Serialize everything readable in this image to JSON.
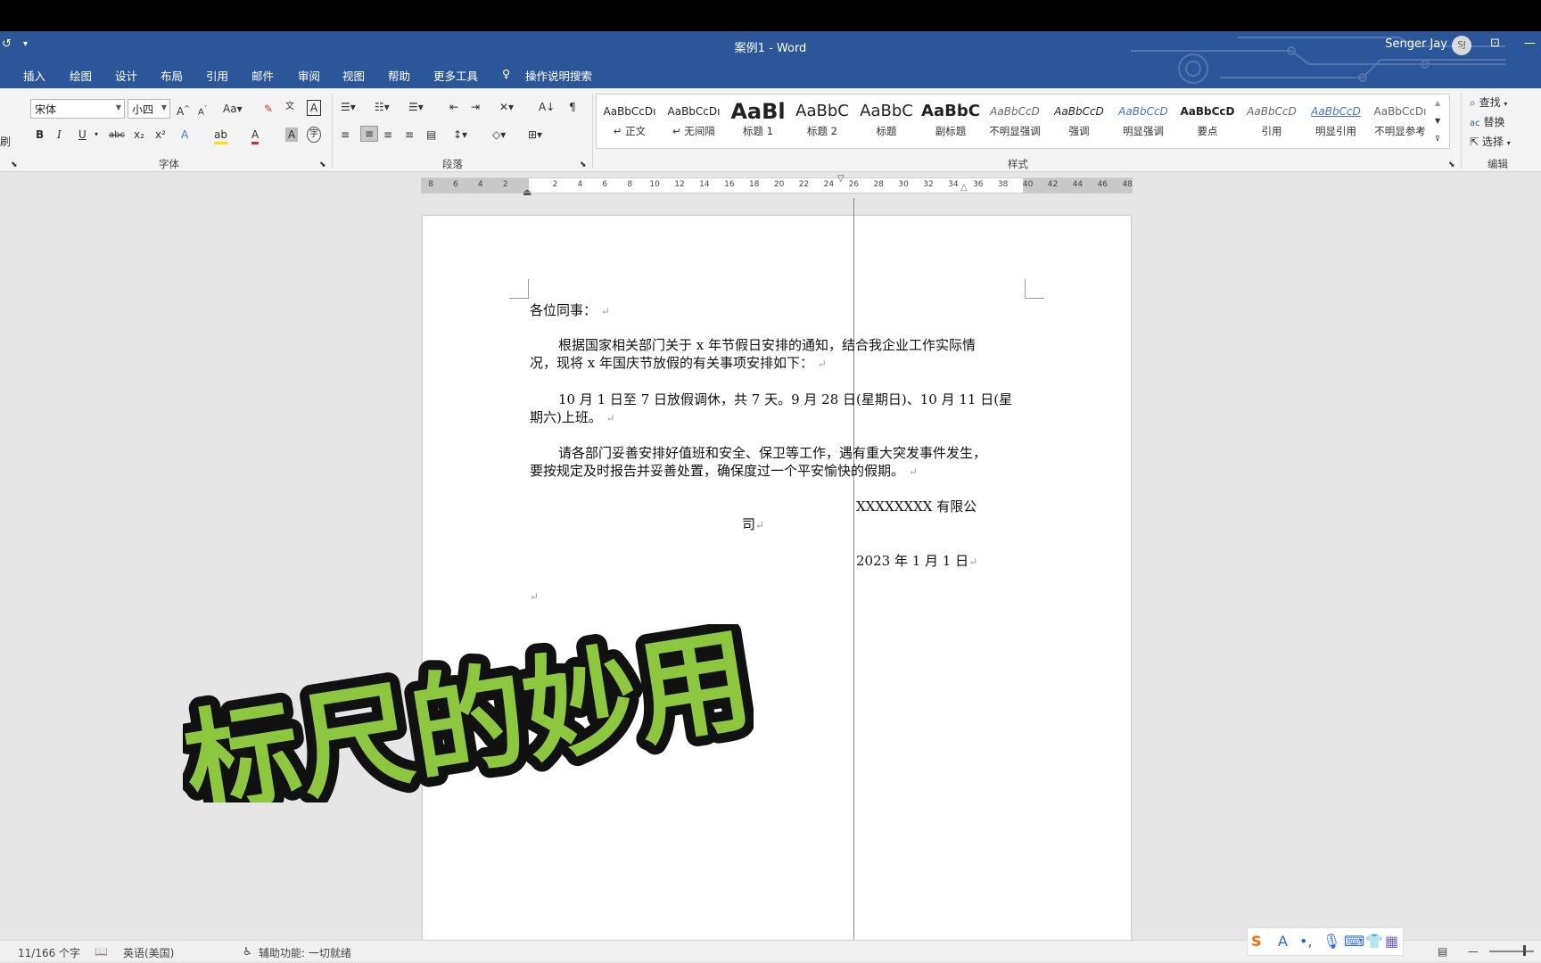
{
  "window": {
    "title": "案例1 - Word",
    "user_name": "Senger Jay",
    "user_initials": "SJ"
  },
  "tabs": [
    "插入",
    "绘图",
    "设计",
    "布局",
    "引用",
    "邮件",
    "审阅",
    "视图",
    "帮助",
    "更多工具"
  ],
  "tell_me": "操作说明搜索",
  "ribbon": {
    "font_name": "宋体",
    "font_size": "小四",
    "group_font": "字体",
    "group_paragraph": "段落",
    "group_styles": "样式",
    "group_editing": "编辑",
    "styles": [
      {
        "preview": "AaBbCcDı",
        "label": "↵ 正文"
      },
      {
        "preview": "AaBbCcDı",
        "label": "↵ 无间隔"
      },
      {
        "preview": "AaBl",
        "label": "标题 1"
      },
      {
        "preview": "AaBbC",
        "label": "标题 2"
      },
      {
        "preview": "AaBbC",
        "label": "标题"
      },
      {
        "preview": "AaBbC",
        "label": "副标题"
      },
      {
        "preview": "AaBbCcD",
        "label": "不明显强调"
      },
      {
        "preview": "AaBbCcD",
        "label": "强调"
      },
      {
        "preview": "AaBbCcD",
        "label": "明显强调"
      },
      {
        "preview": "AaBbCcD",
        "label": "要点"
      },
      {
        "preview": "AaBbCcD",
        "label": "引用"
      },
      {
        "preview": "AaBbCcD",
        "label": "明显引用"
      },
      {
        "preview": "AaBbCcDı",
        "label": "不明显参考"
      }
    ],
    "find": "查找",
    "replace": "替换",
    "select": "选择"
  },
  "ruler_numbers": [
    "8",
    "6",
    "4",
    "2",
    "2",
    "4",
    "6",
    "8",
    "10",
    "12",
    "14",
    "16",
    "18",
    "20",
    "22",
    "24",
    "26",
    "28",
    "30",
    "32",
    "34",
    "36",
    "38",
    "40",
    "42",
    "44",
    "46",
    "48"
  ],
  "document": {
    "greeting": "各位同事：",
    "p1_line1": "根据国家相关部门关于 x 年节假日安排的通知，结合我企业工作实际情",
    "p1_line2": "况，现将 x 年国庆节放假的有关事项安排如下：",
    "p2_line1": "10 月 1 日至 7 日放假调休，共 7 天。9 月 28 日(星期日)、10 月 11 日(星",
    "p2_line2": "期六)上班。",
    "p3_line1": "请各部门妥善安排好值班和安全、保卫等工作，遇有重大突发事件发生，",
    "p3_line2": "要按规定及时报告并妥善处置，确保度过一个平安愉快的假期。",
    "company_line1": "XXXXXXXX 有限公",
    "company_line2": "司",
    "date": "2023 年 1 月 1 日",
    "paragraph_mark": "↵"
  },
  "overlay_title": "标尺的妙用",
  "status": {
    "word_count": "11/166 个字",
    "language": "英语(美国)",
    "accessibility": "辅助功能: 一切就绪"
  },
  "colors": {
    "word_blue": "#2b579a",
    "overlay_green": "#8dc63f",
    "overlay_outline": "#111111"
  }
}
